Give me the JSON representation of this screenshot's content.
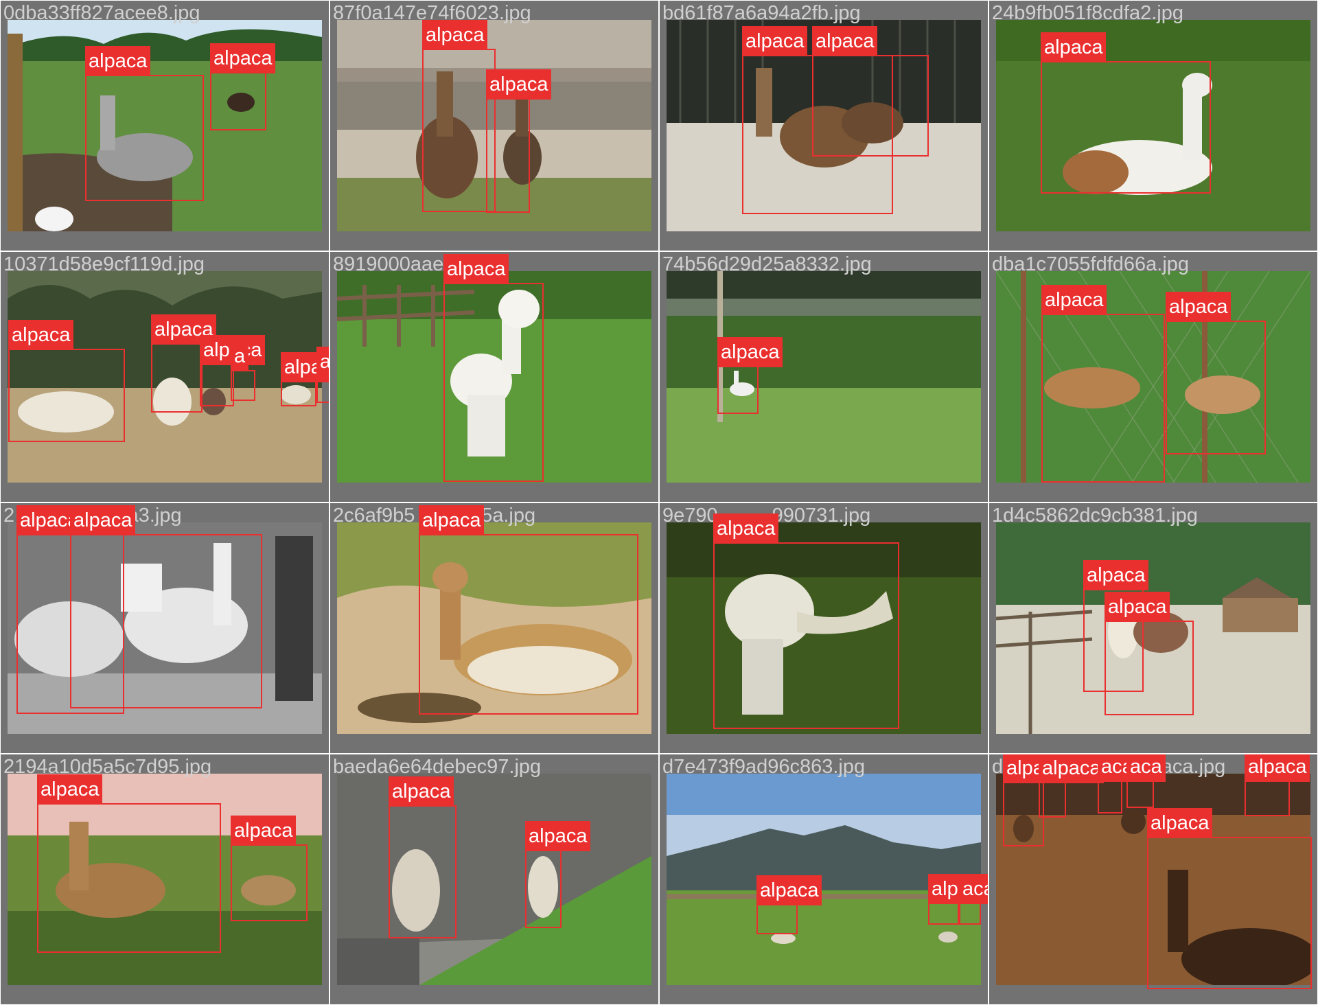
{
  "colors": {
    "tile_bg": "#727272",
    "box": "#ea2f2f",
    "label_bg": "#ea2f2f",
    "label_text": "#ffffff",
    "filename_text": "#d0d0d0"
  },
  "tiles": [
    {
      "file": "0dba33ff827acee8.jpg",
      "scene": "pasture-fence",
      "labels": [
        "alpaca",
        "alpaca"
      ]
    },
    {
      "file": "87f0a147e74f6023.jpg",
      "scene": "stone-wall",
      "labels": [
        "alpaca",
        "alpaca"
      ]
    },
    {
      "file": "bd61f87a6a94a2fb.jpg",
      "scene": "dark-fence",
      "labels": [
        "alpaca",
        "alpaca"
      ]
    },
    {
      "file": "24b9fb051f8cdfa2.jpg",
      "scene": "grass",
      "labels": [
        "alpaca"
      ]
    },
    {
      "file": "10371d58e9cf119d.jpg",
      "scene": "herd-trees",
      "labels": [
        "alpaca",
        "alpaca",
        "alpaca",
        "a",
        "alpaca",
        "alpaca"
      ]
    },
    {
      "file": "8919000aae8",
      "file_tail": "jpg",
      "scene": "grass-fence",
      "labels": [
        "alpaca"
      ]
    },
    {
      "file": "74b56d29d25a8332.jpg",
      "scene": "field-distant",
      "labels": [
        "alpaca"
      ]
    },
    {
      "file": "dba1c7055fdfd66a.jpg",
      "scene": "chain-fence",
      "labels": [
        "alpaca",
        "alpaca"
      ]
    },
    {
      "file": "2",
      "file_tail": "ddca3.jpg",
      "scene": "grayscale",
      "labels": [
        "alpaca",
        "alpaca"
      ]
    },
    {
      "file": "2c6af9b5",
      "file_tail": "5a.jpg",
      "scene": "sand",
      "labels": [
        "alpaca"
      ]
    },
    {
      "file": "9e790",
      "file_tail": "990731.jpg",
      "scene": "blurry-grass",
      "labels": [
        "alpaca"
      ]
    },
    {
      "file": "1d4c5862dc9cb381.jpg",
      "scene": "corral",
      "labels": [
        "alpaca",
        "alpaca"
      ]
    },
    {
      "file": "2194a10d5a5c7d95.jpg",
      "scene": "lake-shore",
      "labels": [
        "alpaca",
        "alpaca"
      ]
    },
    {
      "file": "baeda6e64debec97.jpg",
      "scene": "rock-wall",
      "labels": [
        "alpaca",
        "alpaca"
      ]
    },
    {
      "file": "d7e473f9ad96c863.jpg",
      "scene": "mountains",
      "labels": [
        "alpaca",
        "alpaca",
        "aca"
      ]
    },
    {
      "file": "d",
      "file_tail": "aca.jpg",
      "scene": "dusty-corral",
      "labels": [
        "alpa",
        "alpaca",
        "aca",
        "aca",
        "alpaca",
        "alpaca"
      ]
    }
  ]
}
